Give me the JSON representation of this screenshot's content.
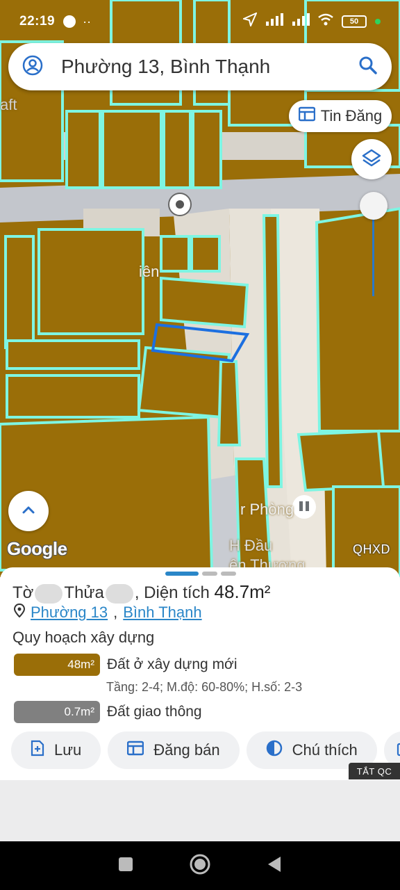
{
  "status_bar": {
    "time": "22:19",
    "battery": "50"
  },
  "search": {
    "text": "Phường 13, Bình Thạnh"
  },
  "map": {
    "tin_dang_label": "Tin Đăng",
    "google_logo": "Google",
    "layer_code": "QHXD",
    "labels": {
      "top_left": "aft",
      "poi_name": "iên",
      "poi_right": "r Phòng",
      "street_a": "H Đầu",
      "street_b": "ên Thượng"
    }
  },
  "parcel": {
    "sheet_label": "Tờ",
    "plot_label": "Thửa",
    "area_label": ", Diện tích",
    "area_value": "48.7m²",
    "ward_link": "Phường 13",
    "district_link": "Bình Thạnh",
    "planning_heading": "Quy hoạch xây dựng",
    "zones": [
      {
        "area": "48m²",
        "name": "Đất ở xây dựng mới",
        "detail": "Tầng: 2-4; M.độ: 60-80%; H.số: 2-3",
        "color": "#9a6e08"
      },
      {
        "area": "0.7m²",
        "name": "Đất giao thông",
        "color": "#808080"
      }
    ]
  },
  "actions": {
    "save": "Lưu",
    "post_sale": "Đăng bán",
    "legend": "Chú thích"
  },
  "ad": {
    "close_label": "TẮT QC"
  },
  "colors": {
    "land": "#9a6e08",
    "parcel_border": "#7ef5e2",
    "road": "#c9ccd2",
    "selected": "#1c6fe0",
    "link": "#2a86c8"
  }
}
